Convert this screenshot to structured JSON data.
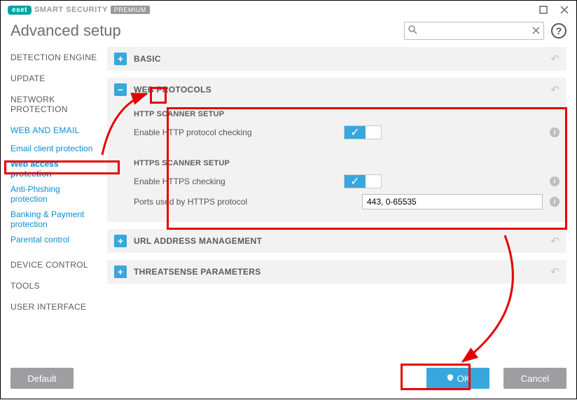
{
  "window": {
    "product_brand": "eset",
    "product_line": "SMART SECURITY",
    "product_variant": "PREMIUM"
  },
  "page": {
    "title": "Advanced setup"
  },
  "search": {
    "value": "",
    "placeholder": ""
  },
  "sidebar": {
    "items": [
      {
        "label": "DETECTION ENGINE"
      },
      {
        "label": "UPDATE"
      },
      {
        "label": "NETWORK PROTECTION"
      },
      {
        "label": "WEB AND EMAIL",
        "selected": true
      },
      {
        "label": "DEVICE CONTROL"
      },
      {
        "label": "TOOLS"
      },
      {
        "label": "USER INTERFACE"
      }
    ],
    "subitems": [
      {
        "label": "Email client protection"
      },
      {
        "label": "Web access protection",
        "active": true
      },
      {
        "label": "Anti-Phishing protection"
      },
      {
        "label": "Banking & Payment protection"
      },
      {
        "label": "Parental control"
      }
    ]
  },
  "sections": {
    "basic": {
      "title": "BASIC"
    },
    "web_protocols": {
      "title": "WEB PROTOCOLS",
      "http_group": "HTTP SCANNER SETUP",
      "http_check_label": "Enable HTTP protocol checking",
      "https_group": "HTTPS SCANNER SETUP",
      "https_check_label": "Enable HTTPS checking",
      "ports_label": "Ports used by HTTPS protocol",
      "ports_value": "443, 0-65535"
    },
    "url_mgmt": {
      "title": "URL ADDRESS MANAGEMENT"
    },
    "threatsense": {
      "title": "THREATSENSE PARAMETERS"
    }
  },
  "buttons": {
    "default": "Default",
    "ok": "OK",
    "cancel": "Cancel"
  }
}
